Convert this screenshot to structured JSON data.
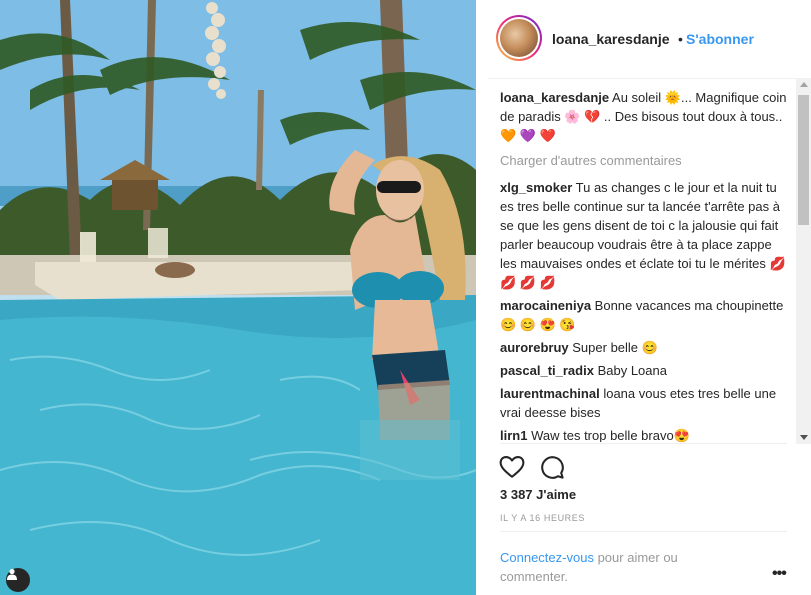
{
  "post": {
    "username": "loana_karesdanje",
    "dot": "•",
    "follow_label": "S'abonner",
    "likes": "3 387 J'aime",
    "time": "IL Y A 16 HEURES",
    "load_more": "Charger d'autres commentaires",
    "login_link": "Connectez-vous",
    "login_rest": "pour aimer ou commenter.",
    "more_label": "•••"
  },
  "comments": [
    {
      "user": "loana_karesdanje",
      "text": "Au soleil 🌞... Magnifique coin de paradis 🌸 💔 .. Des bisous tout doux à tous.. 🧡 💜 ❤️"
    },
    {
      "user": "xlg_smoker",
      "text": "Tu as changes c le jour et la nuit tu es tres belle continue sur ta lancée t'arrête pas à se que les gens disent de toi c la jalousie qui fait parler beaucoup voudrais être à ta place zappe les mauvaises ondes et éclate toi tu le mérites 💋 💋 💋 💋"
    },
    {
      "user": "marocaineniya",
      "text": "Bonne vacances ma choupinette 😊 😊 😍 😘"
    },
    {
      "user": "aurorebruy",
      "text": "Super belle 😊"
    },
    {
      "user": "pascal_ti_radix",
      "text": "Baby Loana"
    },
    {
      "user": "laurentmachinal",
      "text": "loana vous etes tres belle une vrai deesse bises"
    },
    {
      "user": "lirn1",
      "text": "Waw tes trop belle bravo😍"
    }
  ],
  "icons": {
    "like": "heart-icon",
    "comment": "comment-icon",
    "tag": "user-tag-icon"
  },
  "colors": {
    "accent": "#3897f0",
    "text": "#262626",
    "muted": "#999999"
  }
}
